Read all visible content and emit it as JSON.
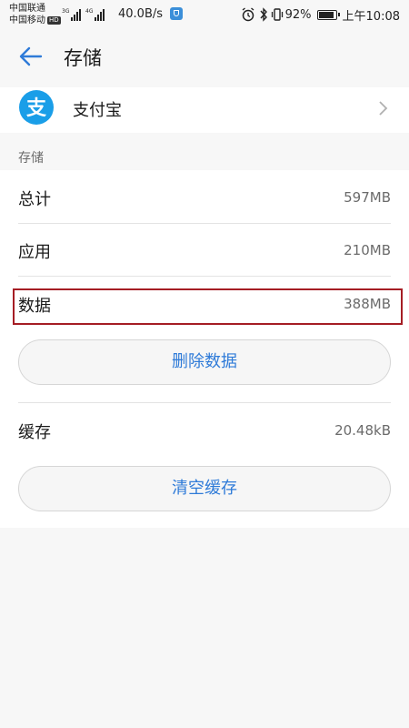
{
  "status_bar": {
    "carrier_1": "中国联通",
    "carrier_2": "中国移动",
    "hd_badge": "HD",
    "net_1": "3G",
    "net_2": "4G",
    "net_speed": "40.0B/s",
    "battery_percent": "92%",
    "time": "上午10:08"
  },
  "header": {
    "title": "存储"
  },
  "app": {
    "name": "支付宝",
    "icon_glyph": "支",
    "icon_color": "#1a9ee8"
  },
  "storage": {
    "section_label": "存储",
    "rows": [
      {
        "label": "总计",
        "value": "597MB"
      },
      {
        "label": "应用",
        "value": "210MB"
      },
      {
        "label": "数据",
        "value": "388MB"
      }
    ],
    "delete_data_button": "删除数据",
    "cache": {
      "label": "缓存",
      "value": "20.48kB"
    },
    "clear_cache_button": "清空缓存"
  },
  "colors": {
    "accent": "#2f7bd8",
    "highlight": "#a51d24",
    "background": "#f7f7f7"
  }
}
